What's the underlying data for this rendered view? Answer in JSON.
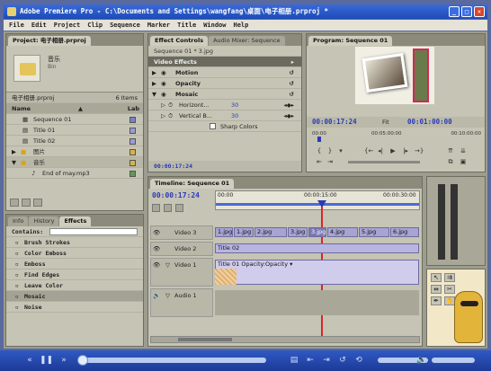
{
  "window": {
    "title": "Adobe Premiere Pro - C:\\Documents and Settings\\wangfang\\桌面\\电子相册.prproj *"
  },
  "menu": [
    "File",
    "Edit",
    "Project",
    "Clip",
    "Sequence",
    "Marker",
    "Title",
    "Window",
    "Help"
  ],
  "project": {
    "tab": "Project: 电子相册.prproj",
    "bin_name": "音乐",
    "bin_type": "Bin",
    "file_name": "电子相册.prproj",
    "item_count": "6 Items",
    "col_name": "Name",
    "col_label": "Lab",
    "items": [
      {
        "name": "Sequence 01",
        "color": "#7d7fc9"
      },
      {
        "name": "Title 01",
        "color": "#9a9bd8"
      },
      {
        "name": "Title 02",
        "color": "#9a9bd8"
      },
      {
        "name": "图片",
        "color": "#d6b24a"
      },
      {
        "name": "音乐",
        "color": "#d6b24a"
      },
      {
        "name": "End of may.mp3",
        "color": "#5f9a5c"
      }
    ]
  },
  "effects_panel": {
    "tabs": [
      "Info",
      "History",
      "Effects"
    ],
    "contains_label": "Contains:",
    "items": [
      "Brush Strokes",
      "Color Emboss",
      "Emboss",
      "Find Edges",
      "Leave Color",
      "Mosaic",
      "Noise"
    ]
  },
  "effect_controls": {
    "tab": "Effect Controls",
    "tab2": "Audio Mixer: Sequence",
    "clip_label": "Sequence 01 * 3.jpg",
    "section": "Video Effects",
    "motion": "Motion",
    "opacity": "Opacity",
    "mosaic": "Mosaic",
    "horizontal_label": "Horizont...",
    "horizontal_value": "30",
    "vertical_label": "Vertical B...",
    "vertical_value": "30",
    "sharp_colors": "Sharp Colors",
    "timecode": "00:00:17:24"
  },
  "program": {
    "tab": "Program: Sequence 01",
    "timecode_current": "00:00:17:24",
    "fit": "Fit",
    "timecode_duration": "00:01:00:00",
    "ruler": [
      "00:00",
      "00:05:00:00",
      "00:10:00:00"
    ]
  },
  "timeline": {
    "tab": "Timeline: Sequence 01",
    "timecode": "00:00:17:24",
    "ruler": [
      "00:00",
      "00:00:15:00",
      "00:00:30:00"
    ],
    "tracks": [
      {
        "name": "Video 3",
        "clips": [
          "1.jpg",
          "1.jpg",
          "2.jpg",
          "3.jpg",
          "3.jpg",
          "4.jpg",
          "5.jpg",
          "6.jpg"
        ]
      },
      {
        "name": "Video 2",
        "clips": [
          "Title 02"
        ]
      },
      {
        "name": "Video 1",
        "clips": [
          "Title 01 Opacity:Opacity ▾"
        ]
      },
      {
        "name": "Audio 1",
        "clips": []
      }
    ]
  }
}
